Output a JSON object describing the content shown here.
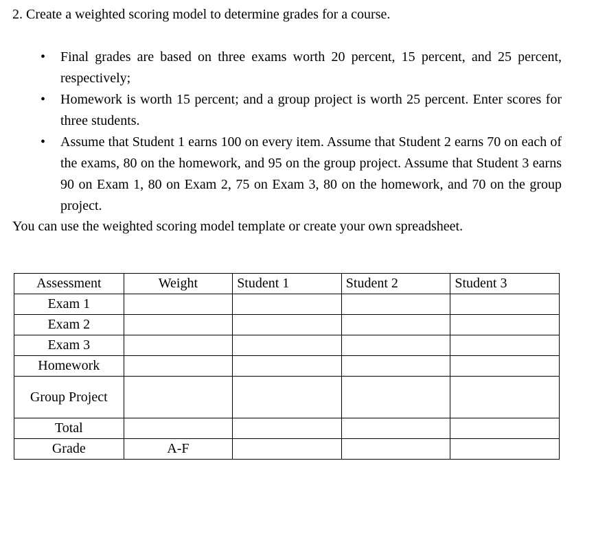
{
  "document": {
    "question_number": "2.",
    "question_text": "2. Create a weighted scoring model to determine grades for a course.",
    "bullets": [
      {
        "marker": "•",
        "text": "Final grades are based on three exams worth 20 percent, 15 percent, and 25 percent, respectively;"
      },
      {
        "marker": "•",
        "text": "Homework is worth 15 percent; and a group project is worth 25 percent. Enter scores for three students."
      },
      {
        "marker": "•",
        "text": "Assume that Student 1 earns 100 on every item. Assume that Student 2 earns 70 on each of the exams, 80 on the homework, and 95 on the group project. Assume that Student 3 earns 90 on Exam 1, 80 on Exam 2, 75 on Exam 3, 80 on the homework, and 70 on the group project."
      }
    ],
    "closing_paragraph": "You can use the weighted scoring model template or create your own spreadsheet."
  },
  "table": {
    "headers": [
      "Assessment",
      "Weight",
      "Student 1",
      "Student 2",
      "Student 3"
    ],
    "rows": [
      {
        "assessment": "Exam 1",
        "weight": "",
        "student1": "",
        "student2": "",
        "student3": "",
        "tall": false
      },
      {
        "assessment": "Exam 2",
        "weight": "",
        "student1": "",
        "student2": "",
        "student3": "",
        "tall": false
      },
      {
        "assessment": "Exam 3",
        "weight": "",
        "student1": "",
        "student2": "",
        "student3": "",
        "tall": false
      },
      {
        "assessment": "Homework",
        "weight": "",
        "student1": "",
        "student2": "",
        "student3": "",
        "tall": false
      },
      {
        "assessment": "Group Project",
        "weight": "",
        "student1": "",
        "student2": "",
        "student3": "",
        "tall": true
      },
      {
        "assessment": "Total",
        "weight": "",
        "student1": "",
        "student2": "",
        "student3": "",
        "tall": false
      },
      {
        "assessment": "Grade",
        "weight": "A-F",
        "student1": "",
        "student2": "",
        "student3": "",
        "tall": false
      }
    ]
  },
  "style": {
    "text_color": "#000000",
    "background_color": "#ffffff",
    "border_color": "#000000"
  }
}
